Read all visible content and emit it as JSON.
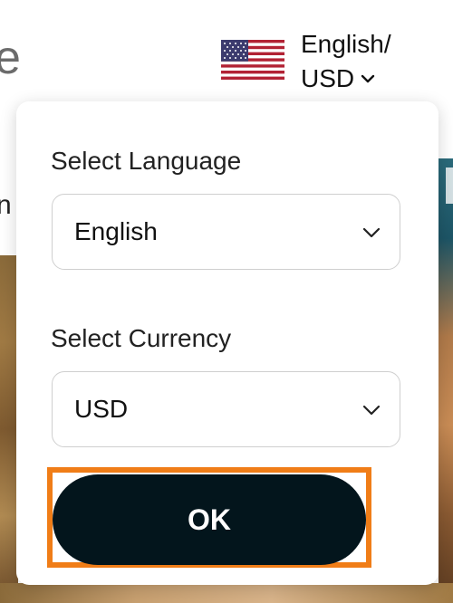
{
  "background": {
    "logo_fragment": "e",
    "nav_fragment": "n"
  },
  "header": {
    "locale_switch": {
      "flag_icon": "us-flag-icon",
      "line1": "English/",
      "line2": "USD"
    }
  },
  "popover": {
    "language": {
      "label": "Select Language",
      "value": "English"
    },
    "currency": {
      "label": "Select Currency",
      "value": "USD"
    },
    "ok_label": "OK"
  },
  "colors": {
    "ok_button_bg": "#03151c",
    "highlight": "#f07d17",
    "flag_red": "#b22234",
    "flag_blue": "#3c3b6e"
  }
}
